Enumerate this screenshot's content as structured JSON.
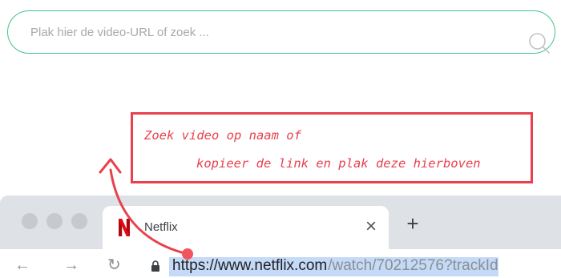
{
  "search": {
    "placeholder": "Plak hier de video-URL of zoek ..."
  },
  "callout": {
    "line1": "Zoek video op naam of",
    "line2": "kopieer de link en plak deze hierboven"
  },
  "browser": {
    "tab": {
      "logo_icon": "netflix-logo-icon",
      "title": "Netflix",
      "close_glyph": "×"
    },
    "new_tab_glyph": "+",
    "nav": {
      "back_glyph": "←",
      "forward_glyph": "→",
      "reload_glyph": "↻"
    },
    "url": {
      "host": "https://www.netflix.com",
      "rest": "/watch/70212576?trackId"
    }
  },
  "colors": {
    "search_border": "#43c58a",
    "callout_red": "#e8414d",
    "url_highlight": "#c5daf7",
    "netflix_red": "#e50914"
  }
}
